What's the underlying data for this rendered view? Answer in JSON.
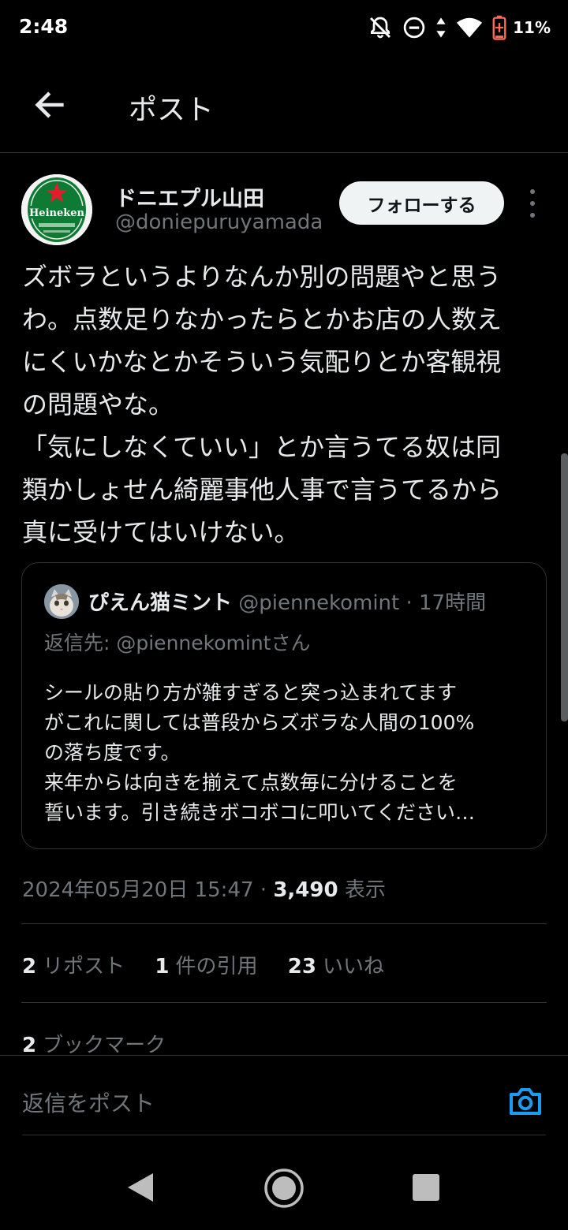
{
  "status_bar": {
    "time": "2:48",
    "battery_percent": "11%",
    "icons": [
      "notifications-off-icon",
      "do-not-disturb-icon",
      "data-transfer-icon",
      "wifi-icon",
      "battery-low-icon"
    ]
  },
  "header": {
    "title": "ポスト",
    "back_icon": "arrow-left-icon"
  },
  "post": {
    "author_name": "ドニエプル山田",
    "author_handle": "@doniepuruyamada",
    "avatar_icon": "beer-label-avatar",
    "avatar_logo_text": "Heineken",
    "follow_label": "フォローする",
    "text_lines": [
      "ズボラというよりなんか別の問題やと思う",
      "わ。点数足りなかったらとかお店の人数え",
      "にくいかなとかそういう気配りとか客観視",
      "の問題やな。",
      "「気にしなくていい」とか言うてる奴は同",
      "類かしょせん綺麗事他人事で言うてるから",
      "真に受けてはいけない。"
    ],
    "date": "2024年05月20日 15:47",
    "separator": "·",
    "views_count": "3,490",
    "views_label": "表示",
    "reposts_count": "2",
    "reposts_label": "リポスト",
    "quotes_count": "1",
    "quotes_label": "件の引用",
    "likes_count": "23",
    "likes_label": "いいね",
    "bookmarks_count": "2",
    "bookmarks_label": "ブックマーク"
  },
  "quoted": {
    "name": "ぴえん猫ミント",
    "handle": "@piennekomint",
    "separator": "·",
    "time": "17時間",
    "reply_to": "返信先: @piennekomintさん",
    "text_lines": [
      "シールの貼り方が雑すぎると突っ込まれてます",
      "がこれに関しては普段からズボラな人間の100%",
      "の落ち度です。",
      "来年からは向きを揃えて点数毎に分けることを",
      "誓います。引き続きボコボコに叩いてください…"
    ]
  },
  "reply_bar": {
    "placeholder": "返信をポスト",
    "camera_icon": "camera-icon",
    "accent_color": "#1d9bf0"
  },
  "nav_bar": {
    "icons": [
      "nav-back-icon",
      "nav-home-icon",
      "nav-recents-icon"
    ]
  }
}
